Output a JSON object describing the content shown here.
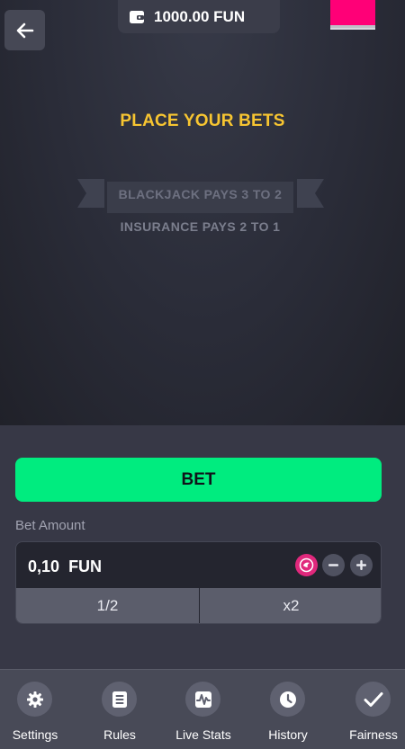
{
  "header": {
    "balance": "1000.00 FUN",
    "back_icon": "arrow-left-icon",
    "wallet_icon": "wallet-icon",
    "swatch_color": "#ff0077"
  },
  "table": {
    "title": "PLACE YOUR BETS",
    "blackjack_pays": "BLACKJACK PAYS 3 TO 2",
    "insurance_pays": "INSURANCE PAYS 2 TO 1"
  },
  "controls": {
    "bet_button": "BET",
    "bet_amount_label": "Bet Amount",
    "amount_value": "0,10",
    "currency": "FUN",
    "half_button": "1/2",
    "double_button": "x2",
    "accent_color": "#00ec7f"
  },
  "nav": {
    "items": [
      {
        "label": "Settings",
        "icon": "gear-icon"
      },
      {
        "label": "Rules",
        "icon": "document-icon"
      },
      {
        "label": "Live Stats",
        "icon": "stats-icon"
      },
      {
        "label": "History",
        "icon": "clock-icon"
      },
      {
        "label": "Fairness",
        "icon": "checkmark-icon"
      }
    ]
  }
}
